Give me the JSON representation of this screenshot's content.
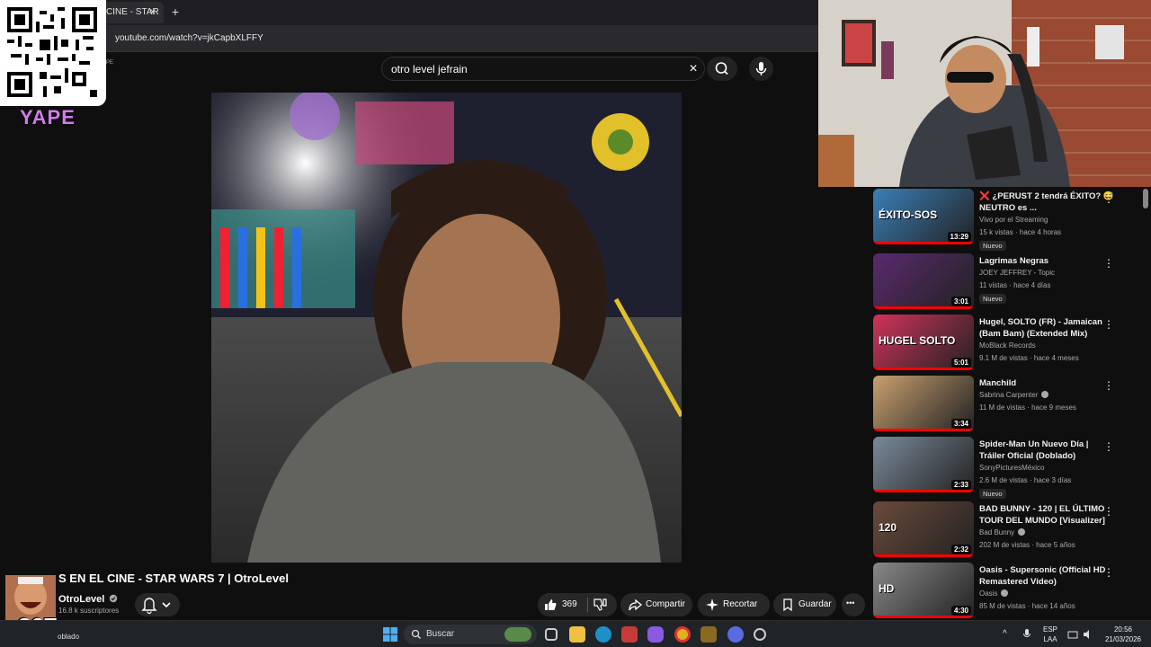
{
  "browser": {
    "tab_title": "CINE - STAR",
    "tab_close": "×",
    "new_tab": "+",
    "url": "youtube.com/watch?v=jkCapbXLFFY"
  },
  "overlay": {
    "yape_label": "YAPE",
    "yape_small": "PE",
    "counter": "x207"
  },
  "search": {
    "query": "otro level jefrain",
    "clear": "×"
  },
  "video": {
    "title": "S EN EL CINE - STAR WARS 7 | OtroLevel",
    "channel": "OtroLevel",
    "subscribers": "16.8 k suscriptores",
    "likes": "369",
    "share_label": "Compartir",
    "clip_label": "Recortar",
    "save_label": "Guardar",
    "more": "•••"
  },
  "recommendations": [
    {
      "title": "❌ ¿PERUST 2 tendrá ÉXITO? 😅 NEUTRO es ...",
      "channel": "Vivo por el Streaming",
      "meta": "15 k vistas · hace 4 horas",
      "badge": "Nuevo",
      "duration": "13:29",
      "verified": false,
      "thumb_color": "#3a7fb8",
      "thumb_text": "ÉXITO-SOS"
    },
    {
      "title": "Lagrimas Negras",
      "channel": "JOEY JEFFREY - Topic",
      "meta": "11 vistas · hace 4 días",
      "badge": "Nuevo",
      "duration": "3:01",
      "verified": false,
      "thumb_color": "#5a2a6e",
      "thumb_text": ""
    },
    {
      "title": "Hugel, SOLTO (FR) - Jamaican (Bam Bam) (Extended Mix)",
      "channel": "MoBlack Records",
      "meta": "9.1 M de vistas · hace 4 meses",
      "badge": "",
      "duration": "5:01",
      "verified": false,
      "thumb_color": "#d0335a",
      "thumb_text": "HUGEL SOLTO"
    },
    {
      "title": "Manchild",
      "channel": "Sabrina Carpenter",
      "meta": "11 M de vistas · hace 9 meses",
      "badge": "",
      "duration": "3:34",
      "verified": true,
      "thumb_color": "#c8a070",
      "thumb_text": ""
    },
    {
      "title": "Spider-Man Un Nuevo Día | Tráiler Oficial (Doblado)",
      "channel": "SonyPicturesMéxico",
      "meta": "2.6 M de vistas · hace 3 días",
      "badge": "Nuevo",
      "duration": "2:33",
      "verified": false,
      "thumb_color": "#7a8a9a",
      "thumb_text": ""
    },
    {
      "title": "BAD BUNNY - 120 | EL ÚLTIMO TOUR DEL MUNDO [Visualizer]",
      "channel": "Bad Bunny",
      "meta": "202 M de vistas · hace 5 años",
      "badge": "",
      "duration": "2:32",
      "verified": true,
      "thumb_color": "#6a4a3a",
      "thumb_text": "120"
    },
    {
      "title": "Oasis - Supersonic (Official HD Remastered Video)",
      "channel": "Oasis",
      "meta": "85 M de vistas · hace 14 años",
      "badge": "",
      "duration": "4:30",
      "verified": true,
      "thumb_color": "#888888",
      "thumb_text": "HD"
    }
  ],
  "taskbar": {
    "search_placeholder": "Buscar",
    "lang_top": "ESP",
    "lang_bottom": "LAA",
    "time": "20:56",
    "date": "21/03/2026",
    "left_caption": "oblado"
  },
  "colors": {
    "accent_red": "#ff0000",
    "yape_purple": "#d27be8"
  }
}
